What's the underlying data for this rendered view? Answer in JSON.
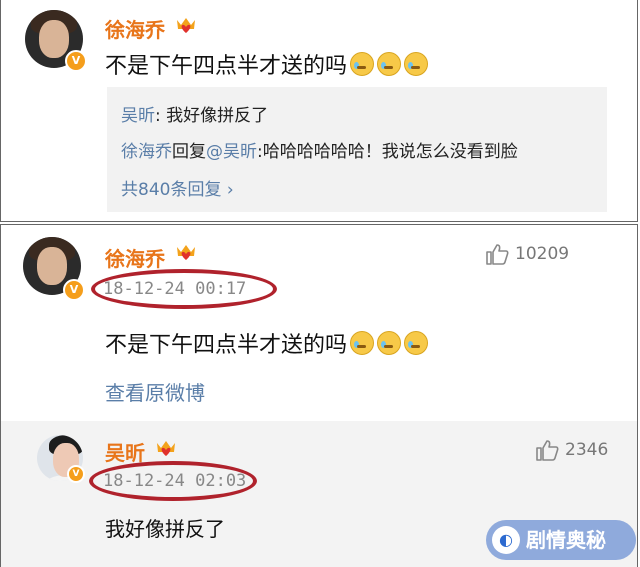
{
  "top_comment": {
    "username": "徐海乔",
    "text": "不是下午四点半才送的吗",
    "replies": [
      {
        "name": "吴昕",
        "text": ": 我好像拼反了"
      },
      {
        "name": "徐海乔",
        "mid": "回复",
        "target": "@吴昕",
        "text": ":哈哈哈哈哈哈！我说怎么没看到脸"
      }
    ],
    "more_replies": "共840条回复 ›"
  },
  "detail_comment": {
    "username": "徐海乔",
    "timestamp": "18-12-24 00:17",
    "likes": "10209",
    "text": "不是下午四点半才送的吗",
    "view_original": "查看原微博"
  },
  "sub_comment": {
    "username": "吴昕",
    "timestamp": "18-12-24 02:03",
    "likes": "2346",
    "text": "我好像拼反了"
  },
  "watermark": {
    "text": "剧情奥秘"
  },
  "colors": {
    "username": "#e8751a",
    "link": "#5a7ea8",
    "highlight_oval": "#b0222c",
    "verified_badge": "#f59e1b"
  },
  "icons": [
    "verified-v-icon",
    "crown-heart-icon",
    "thumbs-up-icon",
    "crying-emoji-icon"
  ]
}
